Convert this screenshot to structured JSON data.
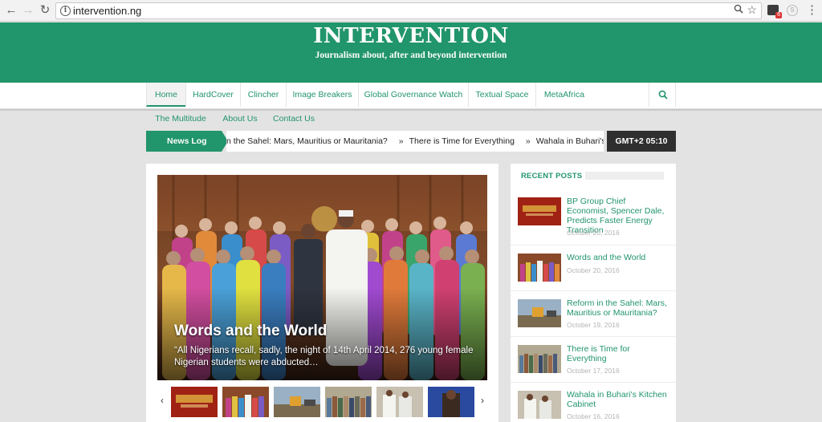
{
  "browser": {
    "back": "←",
    "forward": "→",
    "reload": "↻",
    "info": "i",
    "url": "intervention.ng",
    "zoom_icon": "🔍",
    "star": "☆",
    "ext_badge": "6",
    "menu": "⋮"
  },
  "site": {
    "title": "INTERVENTION",
    "tagline": "Journalism about, after and beyond intervention"
  },
  "nav": {
    "items": [
      "Home",
      "HardCover",
      "Clincher",
      "Image Breakers",
      "Global Governance Watch",
      "Textual Space",
      "MetaAfrica"
    ],
    "row2": [
      "The Multitude",
      "About Us",
      "Contact Us"
    ]
  },
  "ticker": {
    "label": "News Log",
    "items": [
      "n the Sahel: Mars, Mauritius or Mauritania?",
      "There is Time for Everything",
      "Wahala in Buhari's Kitchen Ca"
    ],
    "separator": "»",
    "clock": "GMT+2 05:10"
  },
  "slider": {
    "title": "Words and the World",
    "excerpt": "“All Nigerians recall, sadly, the night of 14th April 2014, 276 young female Nigerian students were abducted…",
    "prev": "‹",
    "next": "›",
    "thumbs": [
      "Words Conference",
      "Group photo",
      "Roadside",
      "Crowd",
      "Officials",
      "Portrait"
    ]
  },
  "sidebar": {
    "heading": "RECENT POSTS",
    "posts": [
      {
        "title": "BP Group Chief Economist, Spencer Dale, Predicts Faster Energy Transition",
        "date": "October 20, 2016"
      },
      {
        "title": "Words and the World",
        "date": "October 20, 2016"
      },
      {
        "title": "Reform in the Sahel: Mars, Mauritius or Mauritania?",
        "date": "October 19, 2016"
      },
      {
        "title": "There is Time for Everything",
        "date": "October 17, 2016"
      },
      {
        "title": "Wahala in Buhari's Kitchen Cabinet",
        "date": "October 16, 2016"
      }
    ]
  },
  "colors": {
    "brand": "#21956b",
    "dark": "#2f2f2f"
  }
}
